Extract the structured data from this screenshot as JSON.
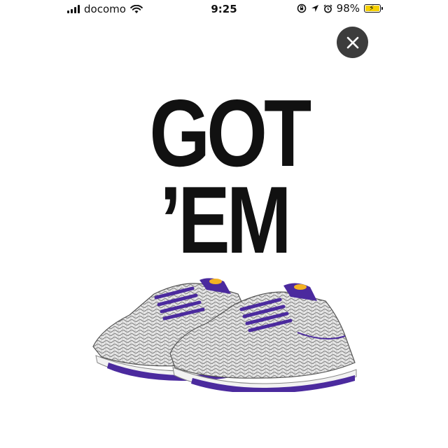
{
  "status_bar": {
    "carrier": "docomo",
    "time": "9:25",
    "battery_percent": "98%",
    "battery_level": 0.98,
    "icons": [
      "signal-icon",
      "wifi-icon",
      "screen-lock-rotation-icon",
      "location-arrow-icon",
      "alarm-icon",
      "battery-icon",
      "charging-bolt-icon"
    ]
  },
  "close_icon": "close-icon",
  "hero": {
    "line1": "GOT",
    "line2": "’EM"
  },
  "product_image": {
    "colors": {
      "accent": "#4b2a9e",
      "sole": "#f2f2f2",
      "pattern": "#8a8a8a",
      "logo": "#f3b323"
    }
  },
  "colors": {
    "close_button_bg": "#3c3c3c",
    "battery_fill": "#f5d000",
    "text": "#111111"
  }
}
